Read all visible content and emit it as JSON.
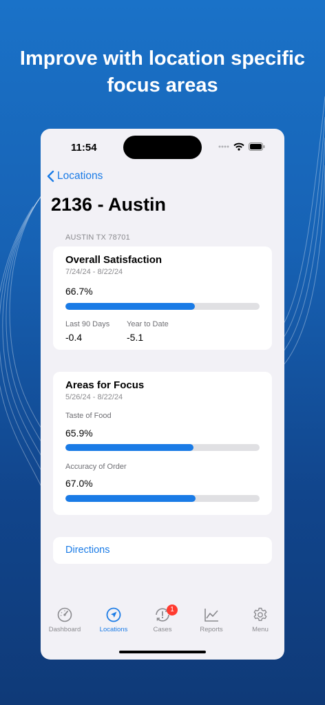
{
  "headline": "Improve with location specific focus areas",
  "status_bar": {
    "time": "11:54"
  },
  "nav": {
    "back_label": "Locations"
  },
  "location": {
    "title": "2136 - Austin",
    "address": "AUSTIN TX 78701"
  },
  "overall": {
    "title": "Overall Satisfaction",
    "date_range": "7/24/24 - 8/22/24",
    "percent_text": "66.7%",
    "progress": 0.667,
    "last90_label": "Last 90 Days",
    "last90_value": "-0.4",
    "ytd_label": "Year to Date",
    "ytd_value": "-5.1"
  },
  "focus": {
    "title": "Areas for Focus",
    "date_range": "5/26/24 - 8/22/24",
    "items": [
      {
        "label": "Taste of Food",
        "percent_text": "65.9%",
        "progress": 0.659
      },
      {
        "label": "Accuracy of Order",
        "percent_text": "67.0%",
        "progress": 0.67
      }
    ]
  },
  "directions_label": "Directions",
  "tabs": [
    {
      "label": "Dashboard",
      "icon": "dashboard-gauge-icon"
    },
    {
      "label": "Locations",
      "icon": "location-arrow-icon",
      "active": true
    },
    {
      "label": "Cases",
      "icon": "cases-icon",
      "badge": "1"
    },
    {
      "label": "Reports",
      "icon": "chart-icon"
    },
    {
      "label": "Menu",
      "icon": "gear-icon"
    }
  ],
  "colors": {
    "accent": "#1a7be6",
    "badge": "#ff3b30",
    "background_top": "#1a72c8",
    "background_bottom": "#0f3a78"
  }
}
